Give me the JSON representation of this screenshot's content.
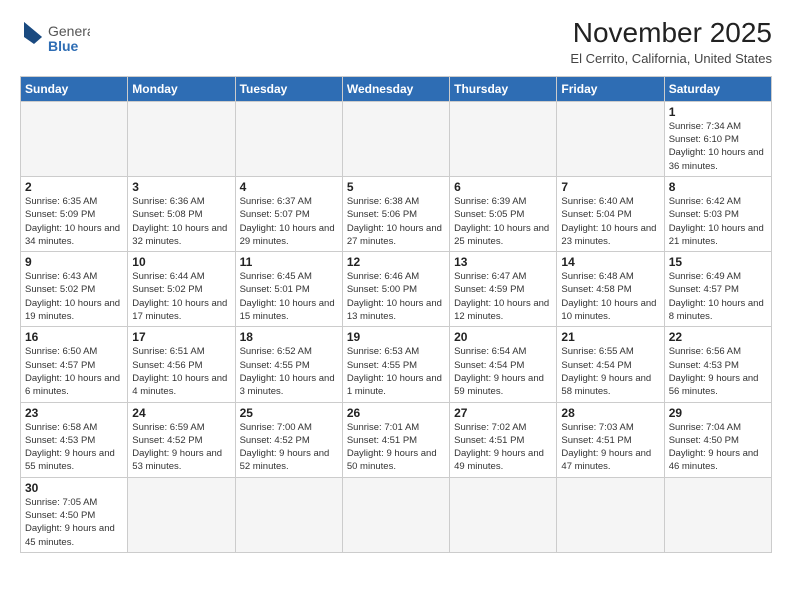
{
  "header": {
    "logo_text_general": "General",
    "logo_text_blue": "Blue",
    "month_title": "November 2025",
    "location": "El Cerrito, California, United States"
  },
  "days_of_week": [
    "Sunday",
    "Monday",
    "Tuesday",
    "Wednesday",
    "Thursday",
    "Friday",
    "Saturday"
  ],
  "weeks": [
    [
      {
        "day": "",
        "info": ""
      },
      {
        "day": "",
        "info": ""
      },
      {
        "day": "",
        "info": ""
      },
      {
        "day": "",
        "info": ""
      },
      {
        "day": "",
        "info": ""
      },
      {
        "day": "",
        "info": ""
      },
      {
        "day": "1",
        "info": "Sunrise: 7:34 AM\nSunset: 6:10 PM\nDaylight: 10 hours and 36 minutes."
      }
    ],
    [
      {
        "day": "2",
        "info": "Sunrise: 6:35 AM\nSunset: 5:09 PM\nDaylight: 10 hours and 34 minutes."
      },
      {
        "day": "3",
        "info": "Sunrise: 6:36 AM\nSunset: 5:08 PM\nDaylight: 10 hours and 32 minutes."
      },
      {
        "day": "4",
        "info": "Sunrise: 6:37 AM\nSunset: 5:07 PM\nDaylight: 10 hours and 29 minutes."
      },
      {
        "day": "5",
        "info": "Sunrise: 6:38 AM\nSunset: 5:06 PM\nDaylight: 10 hours and 27 minutes."
      },
      {
        "day": "6",
        "info": "Sunrise: 6:39 AM\nSunset: 5:05 PM\nDaylight: 10 hours and 25 minutes."
      },
      {
        "day": "7",
        "info": "Sunrise: 6:40 AM\nSunset: 5:04 PM\nDaylight: 10 hours and 23 minutes."
      },
      {
        "day": "8",
        "info": "Sunrise: 6:42 AM\nSunset: 5:03 PM\nDaylight: 10 hours and 21 minutes."
      }
    ],
    [
      {
        "day": "9",
        "info": "Sunrise: 6:43 AM\nSunset: 5:02 PM\nDaylight: 10 hours and 19 minutes."
      },
      {
        "day": "10",
        "info": "Sunrise: 6:44 AM\nSunset: 5:02 PM\nDaylight: 10 hours and 17 minutes."
      },
      {
        "day": "11",
        "info": "Sunrise: 6:45 AM\nSunset: 5:01 PM\nDaylight: 10 hours and 15 minutes."
      },
      {
        "day": "12",
        "info": "Sunrise: 6:46 AM\nSunset: 5:00 PM\nDaylight: 10 hours and 13 minutes."
      },
      {
        "day": "13",
        "info": "Sunrise: 6:47 AM\nSunset: 4:59 PM\nDaylight: 10 hours and 12 minutes."
      },
      {
        "day": "14",
        "info": "Sunrise: 6:48 AM\nSunset: 4:58 PM\nDaylight: 10 hours and 10 minutes."
      },
      {
        "day": "15",
        "info": "Sunrise: 6:49 AM\nSunset: 4:57 PM\nDaylight: 10 hours and 8 minutes."
      }
    ],
    [
      {
        "day": "16",
        "info": "Sunrise: 6:50 AM\nSunset: 4:57 PM\nDaylight: 10 hours and 6 minutes."
      },
      {
        "day": "17",
        "info": "Sunrise: 6:51 AM\nSunset: 4:56 PM\nDaylight: 10 hours and 4 minutes."
      },
      {
        "day": "18",
        "info": "Sunrise: 6:52 AM\nSunset: 4:55 PM\nDaylight: 10 hours and 3 minutes."
      },
      {
        "day": "19",
        "info": "Sunrise: 6:53 AM\nSunset: 4:55 PM\nDaylight: 10 hours and 1 minute."
      },
      {
        "day": "20",
        "info": "Sunrise: 6:54 AM\nSunset: 4:54 PM\nDaylight: 9 hours and 59 minutes."
      },
      {
        "day": "21",
        "info": "Sunrise: 6:55 AM\nSunset: 4:54 PM\nDaylight: 9 hours and 58 minutes."
      },
      {
        "day": "22",
        "info": "Sunrise: 6:56 AM\nSunset: 4:53 PM\nDaylight: 9 hours and 56 minutes."
      }
    ],
    [
      {
        "day": "23",
        "info": "Sunrise: 6:58 AM\nSunset: 4:53 PM\nDaylight: 9 hours and 55 minutes."
      },
      {
        "day": "24",
        "info": "Sunrise: 6:59 AM\nSunset: 4:52 PM\nDaylight: 9 hours and 53 minutes."
      },
      {
        "day": "25",
        "info": "Sunrise: 7:00 AM\nSunset: 4:52 PM\nDaylight: 9 hours and 52 minutes."
      },
      {
        "day": "26",
        "info": "Sunrise: 7:01 AM\nSunset: 4:51 PM\nDaylight: 9 hours and 50 minutes."
      },
      {
        "day": "27",
        "info": "Sunrise: 7:02 AM\nSunset: 4:51 PM\nDaylight: 9 hours and 49 minutes."
      },
      {
        "day": "28",
        "info": "Sunrise: 7:03 AM\nSunset: 4:51 PM\nDaylight: 9 hours and 47 minutes."
      },
      {
        "day": "29",
        "info": "Sunrise: 7:04 AM\nSunset: 4:50 PM\nDaylight: 9 hours and 46 minutes."
      }
    ],
    [
      {
        "day": "30",
        "info": "Sunrise: 7:05 AM\nSunset: 4:50 PM\nDaylight: 9 hours and 45 minutes."
      },
      {
        "day": "",
        "info": ""
      },
      {
        "day": "",
        "info": ""
      },
      {
        "day": "",
        "info": ""
      },
      {
        "day": "",
        "info": ""
      },
      {
        "day": "",
        "info": ""
      },
      {
        "day": "",
        "info": ""
      }
    ]
  ]
}
